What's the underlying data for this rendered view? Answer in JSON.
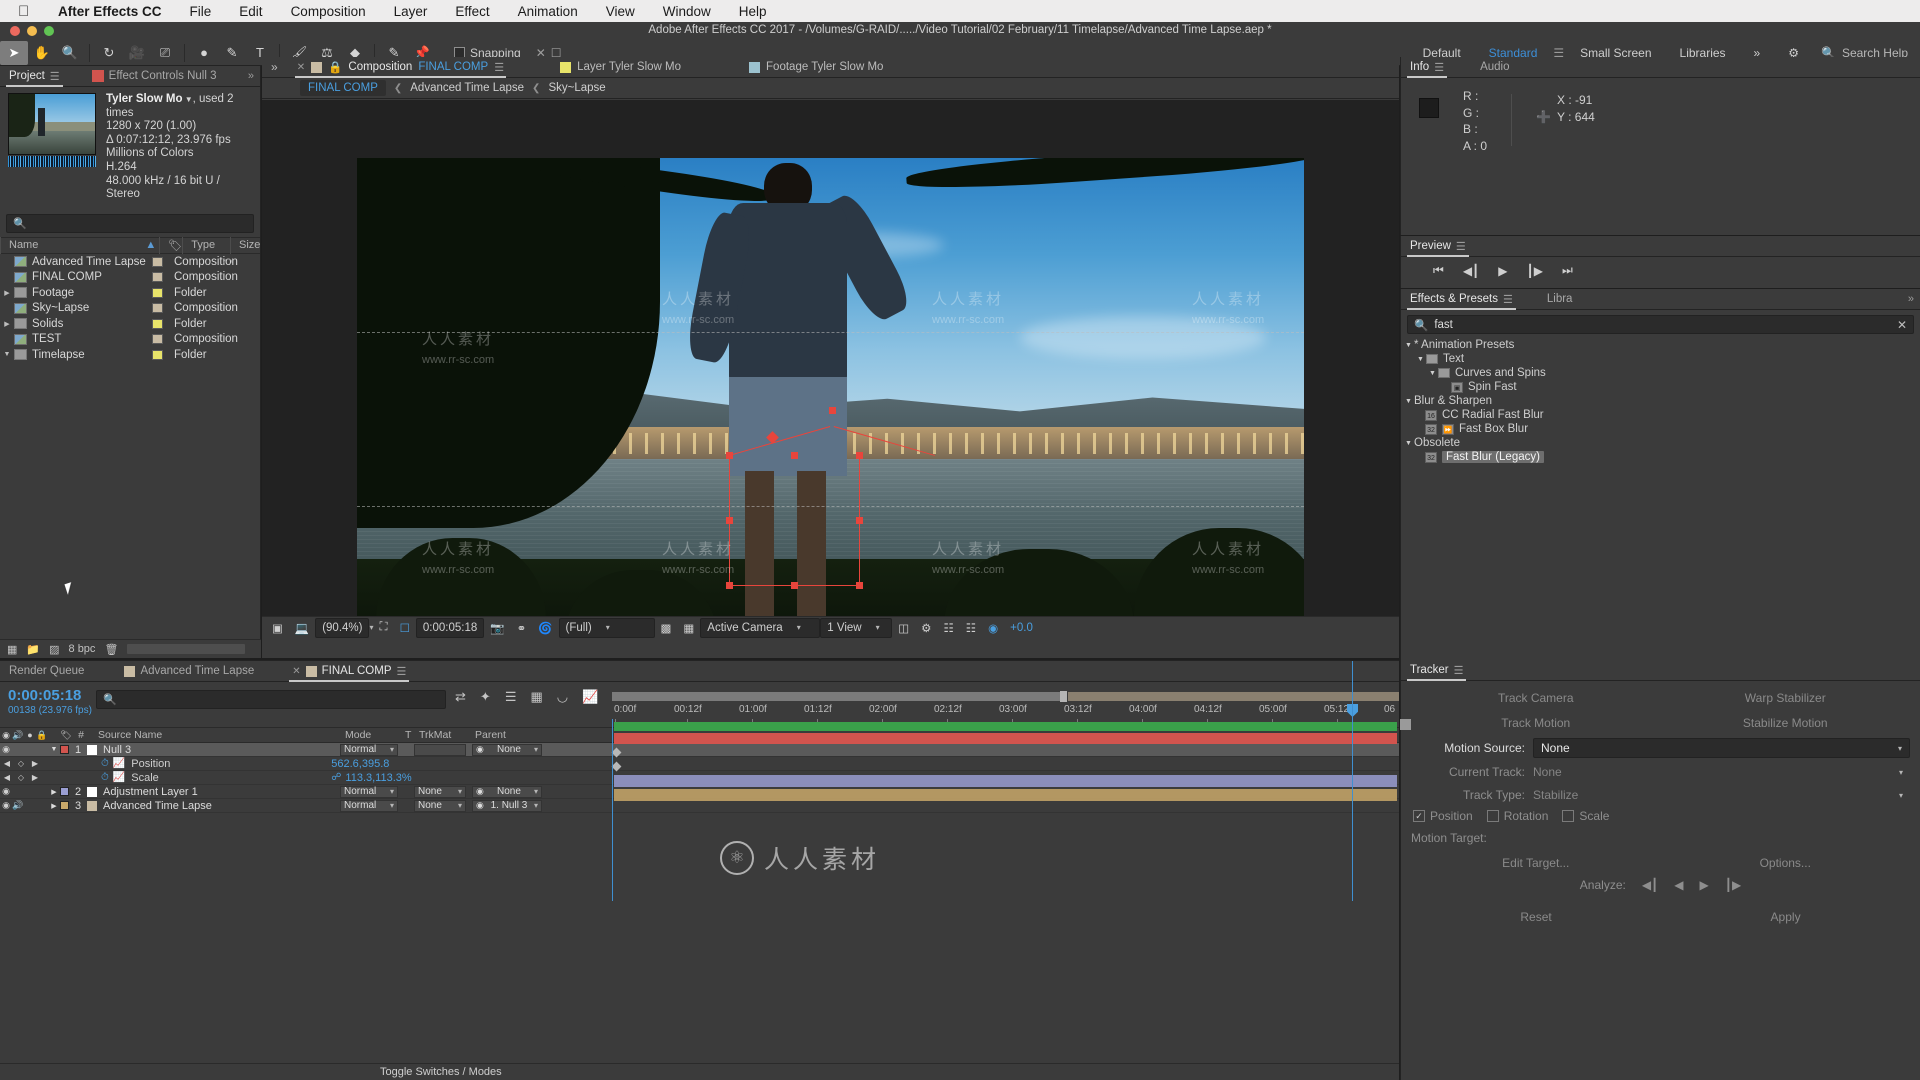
{
  "macmenu": {
    "apple": "",
    "items": [
      "After Effects CC",
      "File",
      "Edit",
      "Composition",
      "Layer",
      "Effect",
      "Animation",
      "View",
      "Window",
      "Help"
    ]
  },
  "window": {
    "title": "Adobe After Effects CC 2017 - /Volumes/G-RAID/...../Video Tutorial/02 February/11 Timelapse/Advanced Time Lapse.aep *"
  },
  "toolbar": {
    "tools": [
      "selection-tool",
      "hand-tool",
      "zoom-tool",
      "rotation-tool",
      "camera-tool",
      "pan-behind-tool",
      "shape-tool",
      "pen-tool",
      "type-tool",
      "brush-tool",
      "clone-stamp-tool",
      "eraser-tool",
      "roto-brush-tool",
      "puppet-pin-tool"
    ],
    "snapping_label": "Snapping",
    "workspaces": [
      "Default",
      "Standard",
      "Small Screen",
      "Libraries"
    ],
    "workspace_selected": "Standard",
    "overflow": "»",
    "search_help": "Search Help"
  },
  "project": {
    "tabs": [
      {
        "label": "Project",
        "selected": true
      },
      {
        "label": "Effect Controls Null 3",
        "selected": false
      }
    ],
    "meta": {
      "name": "Tyler Slow Mo",
      "used": ", used 2 times",
      "dimensions": "1280 x 720 (1.00)",
      "duration": "Δ 0:07:12:12, 23.976 fps",
      "colors": "Millions of Colors",
      "codec": "H.264",
      "audio": "48.000 kHz / 16 bit U / Stereo"
    },
    "search_placeholder": "",
    "columns": [
      "Name",
      "Type",
      "Size"
    ],
    "items": [
      {
        "name": "Advanced Time Lapse",
        "type": "Composition",
        "kind": "comp",
        "expand": false
      },
      {
        "name": "FINAL COMP",
        "type": "Composition",
        "kind": "comp",
        "expand": false
      },
      {
        "name": "Footage",
        "type": "Folder",
        "kind": "folder",
        "expand": "collapsed"
      },
      {
        "name": "Sky~Lapse",
        "type": "Composition",
        "kind": "comp",
        "expand": false
      },
      {
        "name": "Solids",
        "type": "Folder",
        "kind": "folder",
        "expand": "collapsed"
      },
      {
        "name": "TEST",
        "type": "Composition",
        "kind": "comp",
        "expand": false
      },
      {
        "name": "Timelapse",
        "type": "Folder",
        "kind": "folder",
        "expand": "expanded"
      }
    ],
    "footer": {
      "bpc": "8 bpc"
    }
  },
  "comp": {
    "tabs": [
      {
        "label": "Composition",
        "highlight": "FINAL COMP",
        "selected": true,
        "color": "#c9bca4"
      },
      {
        "label": "Layer Tyler Slow Mo",
        "selected": false,
        "color": "#e8e46a"
      },
      {
        "label": "Footage Tyler Slow Mo",
        "selected": false,
        "color": "#9cc2cf"
      }
    ],
    "breadcrumb": [
      {
        "label": "FINAL COMP",
        "current": true
      },
      {
        "label": "Advanced Time Lapse",
        "current": false
      },
      {
        "label": "Sky~Lapse",
        "current": false
      }
    ],
    "toolbar": {
      "zoom": "(90.4%)",
      "time": "0:00:05:18",
      "resolution": "(Full)",
      "camera": "Active Camera",
      "views": "1 View",
      "exposure": "+0.0"
    },
    "watermarks": [
      "人人素材",
      "www.rr-sc.com"
    ]
  },
  "info": {
    "tabs": [
      {
        "label": "Info",
        "selected": true
      },
      {
        "label": "Audio",
        "selected": false
      }
    ],
    "r": "R :",
    "g": "G :",
    "b": "B :",
    "a": "A : 0",
    "x": "X : -91",
    "y": "Y : 644"
  },
  "preview": {
    "tabs": [
      {
        "label": "Preview",
        "selected": true
      }
    ],
    "buttons": [
      "first-frame",
      "previous-frame",
      "play",
      "next-frame",
      "last-frame"
    ]
  },
  "effects": {
    "tabs": [
      {
        "label": "Effects & Presets",
        "selected": true
      },
      {
        "label": "Libra",
        "selected": false
      }
    ],
    "search_value": "fast",
    "tree": [
      {
        "label": "* Animation Presets",
        "depth": 0,
        "tri": "down",
        "icon": "none",
        "selected": false
      },
      {
        "label": "Text",
        "depth": 1,
        "tri": "down",
        "icon": "folder",
        "selected": false
      },
      {
        "label": "Curves and Spins",
        "depth": 2,
        "tri": "down",
        "icon": "folder",
        "selected": false
      },
      {
        "label": "Spin Fast",
        "depth": 3,
        "tri": "none",
        "icon": "preset",
        "selected": false
      },
      {
        "label": "Blur & Sharpen",
        "depth": 0,
        "tri": "down",
        "icon": "none",
        "selected": false
      },
      {
        "label": "CC Radial Fast Blur",
        "depth": 1,
        "tri": "none",
        "icon": "fx16",
        "selected": false
      },
      {
        "label": "Fast Box Blur",
        "depth": 1,
        "tri": "none",
        "icon": "fx32gpu",
        "selected": false
      },
      {
        "label": "Obsolete",
        "depth": 0,
        "tri": "down",
        "icon": "none",
        "selected": false
      },
      {
        "label": "Fast Blur (Legacy)",
        "depth": 1,
        "tri": "none",
        "icon": "fx32",
        "selected": true
      }
    ]
  },
  "tracker": {
    "tabs": [
      {
        "label": "Tracker",
        "selected": true
      }
    ],
    "buttons": [
      "Track Camera",
      "Warp Stabilizer",
      "Track Motion",
      "Stabilize Motion"
    ],
    "motion_source_label": "Motion Source:",
    "motion_source_value": "None",
    "current_track_label": "Current Track:",
    "current_track_value": "None",
    "track_type_label": "Track Type:",
    "track_type_value": "Stabilize",
    "checks": [
      {
        "label": "Position",
        "checked": true
      },
      {
        "label": "Rotation",
        "checked": false
      },
      {
        "label": "Scale",
        "checked": false
      }
    ],
    "motion_target_label": "Motion Target:",
    "edit_target": "Edit Target...",
    "options": "Options...",
    "analyze_label": "Analyze:",
    "reset": "Reset",
    "apply": "Apply"
  },
  "timeline": {
    "tabs": [
      {
        "label": "Render Queue",
        "selected": false
      },
      {
        "label": "Advanced Time Lapse",
        "selected": false
      },
      {
        "label": "FINAL COMP",
        "selected": true
      }
    ],
    "current_time": "0:00:05:18",
    "frame_info": "00138 (23.976 fps)",
    "search_placeholder": "",
    "columns": [
      "Source Name",
      "Mode",
      "T",
      "TrkMat",
      "Parent"
    ],
    "col_hash": "#",
    "ruler_labels": [
      "0:00f",
      "00:12f",
      "01:00f",
      "01:12f",
      "02:00f",
      "02:12f",
      "03:00f",
      "03:12f",
      "04:00f",
      "04:12f",
      "05:00f",
      "05:12f",
      "06"
    ],
    "layers": [
      {
        "index": "1",
        "name": "Null 3",
        "mode": "Normal",
        "trkmat": "",
        "parent": "None",
        "selected": true,
        "color": "#d2544e",
        "expanded": true,
        "properties": [
          {
            "name": "Position",
            "value": "562.6,395.8",
            "keyframes": true
          },
          {
            "name": "Scale",
            "value": "113.3,113.3%",
            "keyframes": true,
            "link": true
          }
        ]
      },
      {
        "index": "2",
        "name": "Adjustment Layer 1",
        "mode": "Normal",
        "trkmat": "None",
        "parent": "None",
        "selected": false,
        "color": "#9a9ed2",
        "expanded": false,
        "properties": []
      },
      {
        "index": "3",
        "name": "Advanced Time Lapse",
        "mode": "Normal",
        "trkmat": "None",
        "parent": "1. Null 3",
        "selected": false,
        "color": "#c9a86a",
        "expanded": false,
        "properties": []
      }
    ],
    "toggle_switches": "Toggle Switches / Modes"
  }
}
